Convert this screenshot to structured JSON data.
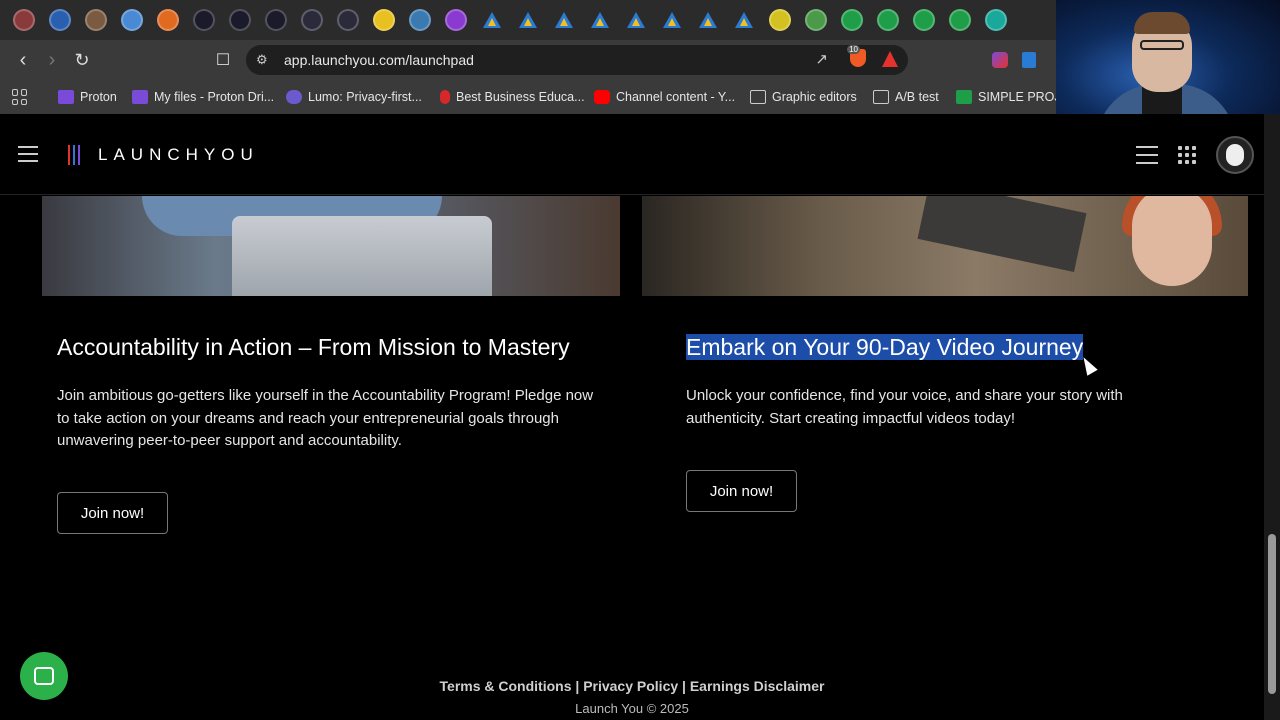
{
  "browser": {
    "url": "app.launchyou.com/launchpad",
    "bookmarks": [
      {
        "label": "Proton",
        "icon": "proton-folder-icon",
        "color": "#7a4bd9"
      },
      {
        "label": "My files - Proton Dri...",
        "icon": "proton-drive-icon",
        "color": "#7a4bd9"
      },
      {
        "label": "Lumo: Privacy-first...",
        "icon": "lumo-icon",
        "color": "#6a5acd"
      },
      {
        "label": "Best Business Educa...",
        "icon": "pin-icon",
        "color": "#d62828"
      },
      {
        "label": "Channel content - Y...",
        "icon": "youtube-icon",
        "color": "#ff0000"
      },
      {
        "label": "Graphic editors",
        "icon": "folder-icon",
        "color": "#cccccc"
      },
      {
        "label": "A/B test",
        "icon": "folder-icon",
        "color": "#cccccc"
      },
      {
        "label": "SIMPLE PROJEC",
        "icon": "sheets-icon",
        "color": "#1e9e48"
      }
    ],
    "brave_badge": "10"
  },
  "site": {
    "logo_text": "LAUNCHYOU",
    "brand_colors": [
      "#e5322d",
      "#2a7bd4",
      "#7a4bd9"
    ]
  },
  "cards": [
    {
      "title": "Accountability in Action – From Mission to Mastery",
      "text": "Join ambitious go-getters like yourself in the Accountability Program! Pledge now to take action on your dreams and reach your entrepreneurial goals through unwavering peer-to-peer support and accountability.",
      "button": "Join now!"
    },
    {
      "title": "Embark on Your 90-Day Video Journey",
      "text": "Unlock your confidence, find your voice, and share your story with authenticity. Start creating impactful videos today!",
      "button": "Join now!"
    }
  ],
  "footer": {
    "terms": "Terms & Conditions",
    "privacy": "Privacy Policy",
    "earnings": "Earnings Disclaimer",
    "separator": "|",
    "copyright": "Launch You © 2025"
  }
}
